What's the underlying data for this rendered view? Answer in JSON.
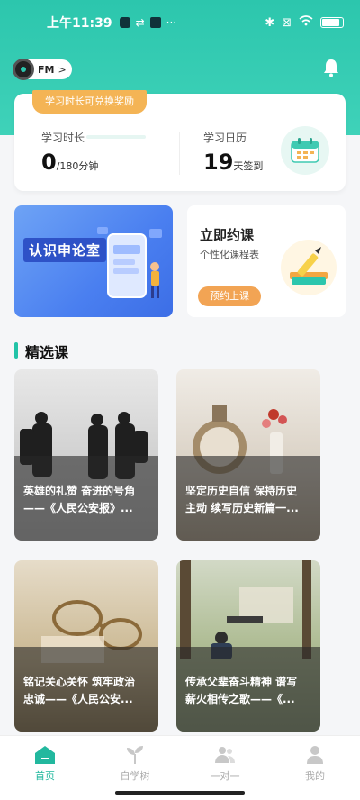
{
  "status_bar": {
    "time": "上午11:39",
    "dots": "···"
  },
  "fm": {
    "label": "FM",
    "arrow": ">"
  },
  "stats": {
    "badge": "学习时长可兑换奖励",
    "duration_label": "学习时长",
    "duration_value": "0",
    "duration_unit": "/180分钟",
    "calendar_label": "学习日历",
    "calendar_value": "19",
    "calendar_unit": "天签到"
  },
  "banner": {
    "title": "认识申论室"
  },
  "appointment": {
    "title": "立即约课",
    "subtitle": "个性化课程表",
    "button": "预约上课"
  },
  "section": {
    "title": "精选课"
  },
  "courses": [
    {
      "line1": "英雄的礼赞 奋进的号角",
      "line2": "——《人民公安报》..."
    },
    {
      "line1": "坚定历史自信 保持历史",
      "line2": "主动 续写历史新篇一..."
    },
    {
      "line1": "铭记关心关怀 筑牢政治",
      "line2": "忠诚——《人民公安..."
    },
    {
      "line1": "传承父辈奋斗精神 谱写",
      "line2": "薪火相传之歌——《..."
    }
  ],
  "tabs": [
    {
      "label": "首页",
      "icon": "home-icon"
    },
    {
      "label": "自学树",
      "icon": "sprout-icon"
    },
    {
      "label": "一对一",
      "icon": "users-icon"
    },
    {
      "label": "我的",
      "icon": "profile-icon"
    }
  ],
  "colors": {
    "accent": "#2cc6ad",
    "orange": "#f2a454"
  }
}
